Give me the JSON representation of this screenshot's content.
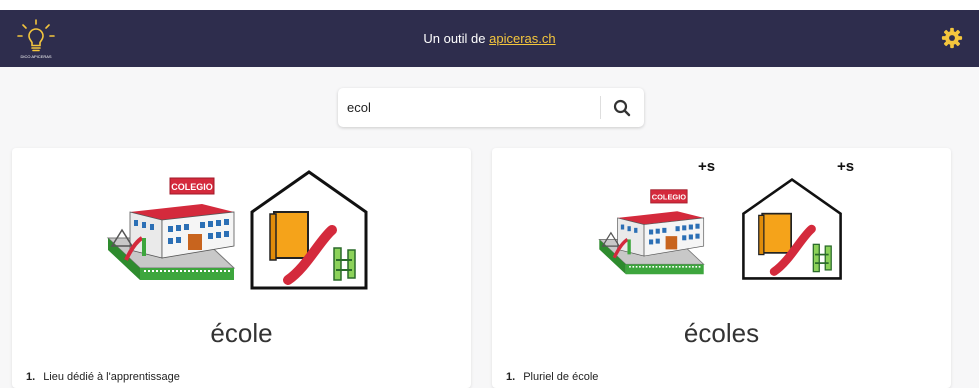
{
  "header": {
    "prefix": "Un outil de",
    "link": "apiceras.ch",
    "logo_text": "DICO APICERAS",
    "colors": {
      "bar": "#2e2d4d",
      "accent": "#f4c63d"
    },
    "icons": {
      "logo": "lightbulb-icon",
      "settings": "gear-icon"
    }
  },
  "search": {
    "value": "ecol",
    "icon": "search-icon"
  },
  "results": [
    {
      "word": "école",
      "school_sign": "COLEGIO",
      "plural_marker": "",
      "definitions": [
        {
          "num": "1.",
          "text": "Lieu dédié à l'apprentissage"
        }
      ]
    },
    {
      "word": "écoles",
      "school_sign": "COLEGIO",
      "plural_marker": "+s",
      "definitions": [
        {
          "num": "1.",
          "text": "Pluriel de école"
        }
      ]
    }
  ]
}
